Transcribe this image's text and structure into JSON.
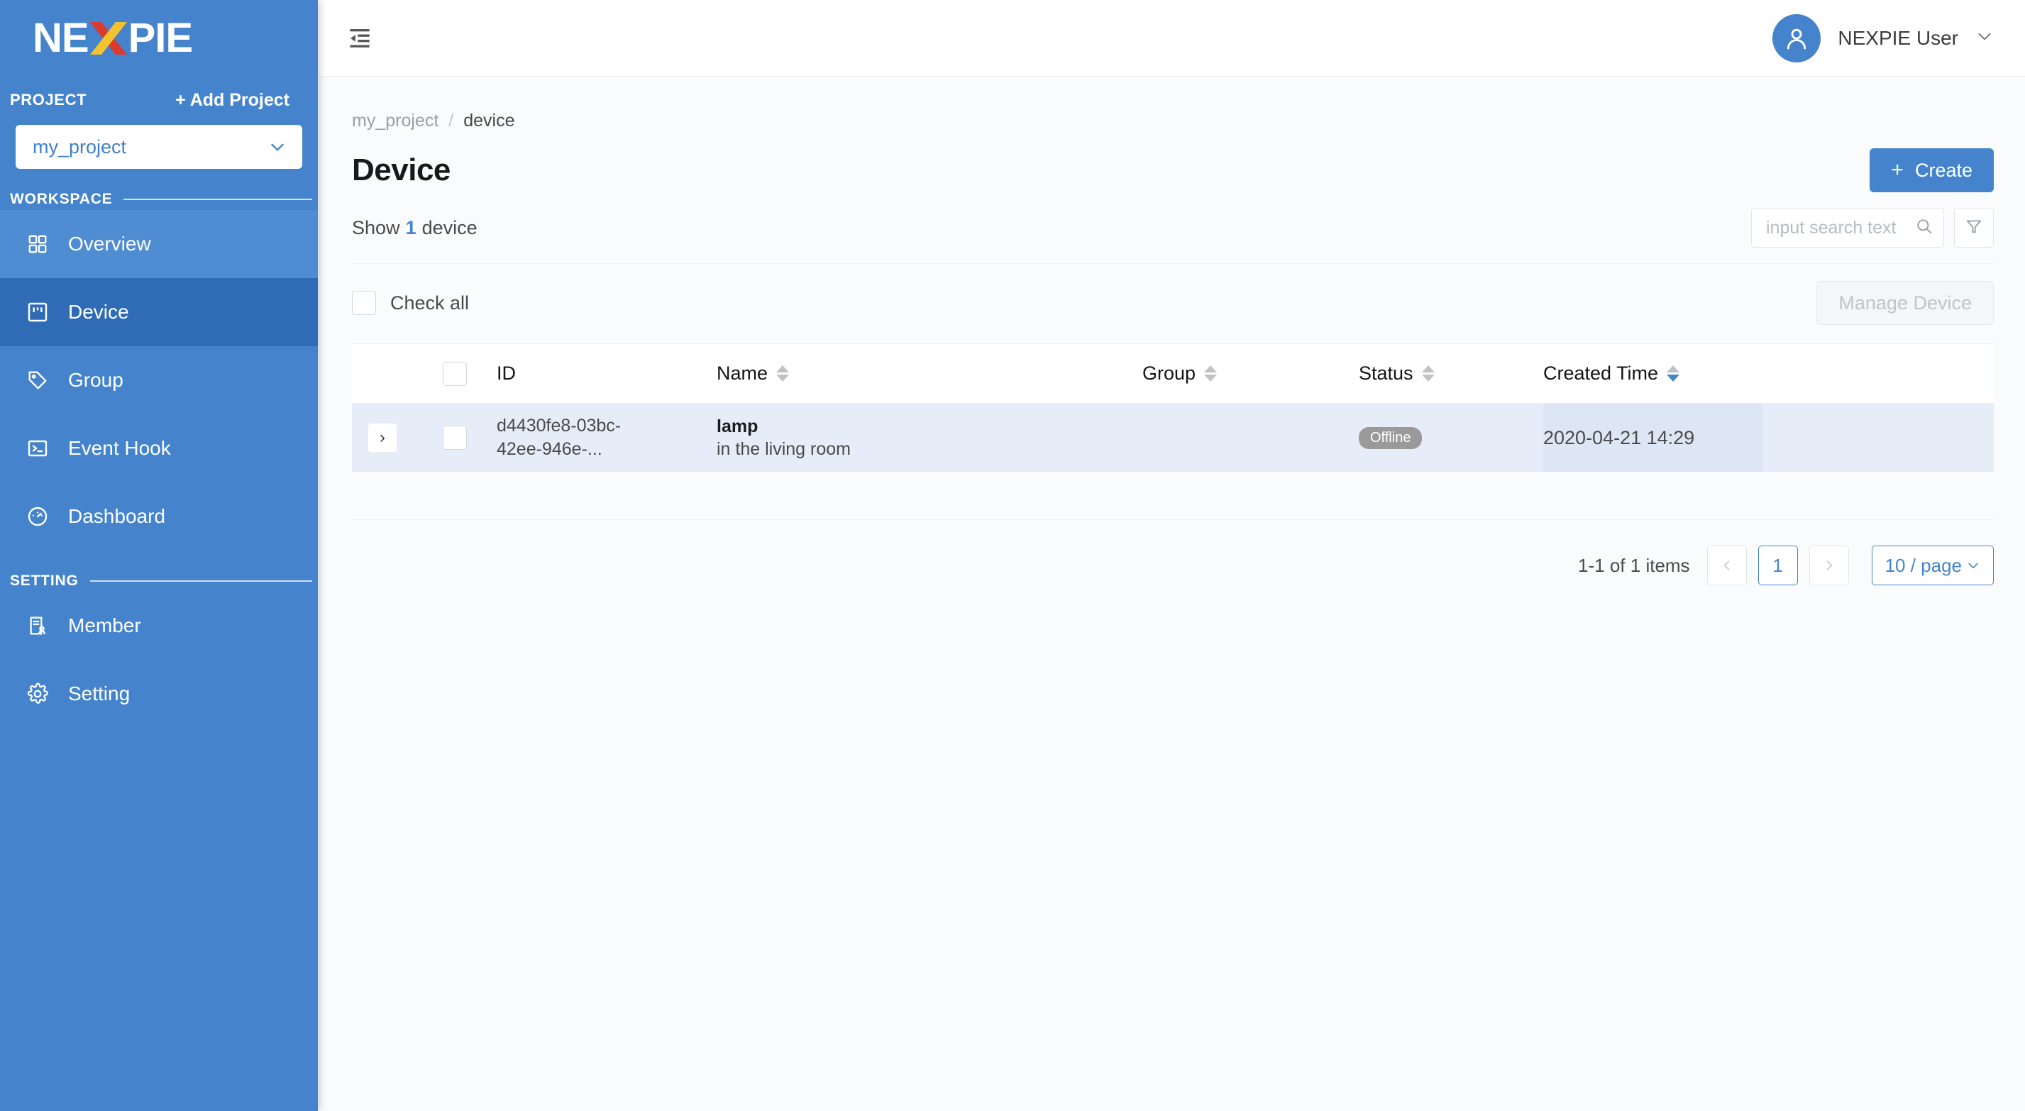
{
  "brand": {
    "logo_part1": "NE",
    "logo_part2": "PIE",
    "logo_x": "X",
    "colors": {
      "sidebar": "#4584cc",
      "accent": "#4584cc",
      "logo_x_red": "#d93b30",
      "logo_x_yellow": "#f2c230"
    }
  },
  "sidebar": {
    "project_label": "PROJECT",
    "add_project_label": "+ Add Project",
    "project_selected": "my_project",
    "workspace_label": "WORKSPACE",
    "setting_label": "SETTING",
    "workspace_items": [
      {
        "label": "Overview",
        "icon": "grid-icon",
        "state": "hovered"
      },
      {
        "label": "Device",
        "icon": "device-icon",
        "state": "active"
      },
      {
        "label": "Group",
        "icon": "tag-icon",
        "state": "normal"
      },
      {
        "label": "Event Hook",
        "icon": "terminal-icon",
        "state": "normal"
      },
      {
        "label": "Dashboard",
        "icon": "gauge-icon",
        "state": "normal"
      }
    ],
    "setting_items": [
      {
        "label": "Member",
        "icon": "member-icon",
        "state": "normal"
      },
      {
        "label": "Setting",
        "icon": "gear-icon",
        "state": "normal"
      }
    ]
  },
  "topbar": {
    "fold_icon": "menu-fold-icon",
    "user_name": "NEXPIE User",
    "user_caret": "chevron-down-icon"
  },
  "breadcrumb": {
    "project": "my_project",
    "separator": "/",
    "current": "device"
  },
  "page": {
    "title": "Device",
    "create_label": "Create",
    "create_plus": "+",
    "show_prefix": "Show",
    "show_count": "1",
    "show_suffix": "device",
    "check_all_label": "Check all",
    "manage_device_label": "Manage Device"
  },
  "search": {
    "placeholder": "input search text",
    "value": "",
    "icon": "search-icon",
    "filter_icon": "filter-icon"
  },
  "table": {
    "columns": [
      {
        "key": "id",
        "label": "ID",
        "sortable": false
      },
      {
        "key": "name",
        "label": "Name",
        "sortable": true,
        "sort": "none"
      },
      {
        "key": "group",
        "label": "Group",
        "sortable": true,
        "sort": "none"
      },
      {
        "key": "status",
        "label": "Status",
        "sortable": true,
        "sort": "none"
      },
      {
        "key": "created",
        "label": "Created Time",
        "sortable": true,
        "sort": "desc"
      }
    ],
    "rows": [
      {
        "expand_icon": "chevron-right-icon",
        "checked": false,
        "id": "d4430fe8-03bc-42ee-946e-...",
        "id_line1": "d4430fe8-03bc-",
        "id_line2": "42ee-946e-...",
        "name": "lamp",
        "description": "in the living room",
        "group": "",
        "status": "Offline",
        "created_time": "2020-04-21 14:29"
      }
    ]
  },
  "pagination": {
    "summary": "1-1 of 1 items",
    "prev_icon": "chevron-left-icon",
    "next_icon": "chevron-right-icon",
    "current_page": "1",
    "page_size": "10 / page",
    "page_size_caret": "chevron-down-icon"
  }
}
